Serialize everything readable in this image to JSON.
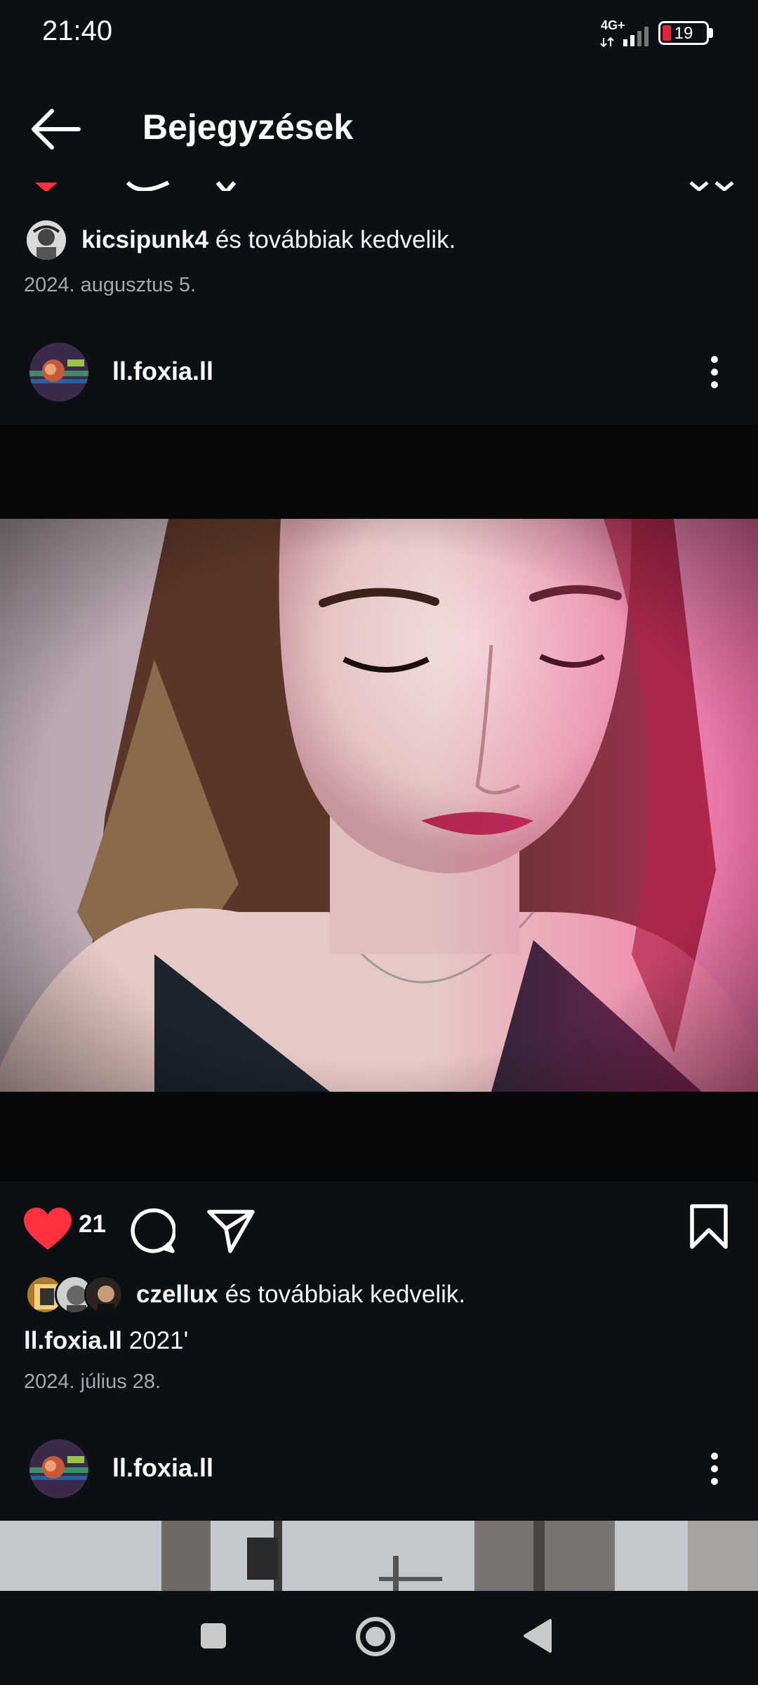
{
  "status_bar": {
    "time": "21:40",
    "network": "4G+",
    "battery": "19"
  },
  "header": {
    "title": "Bejegyzések"
  },
  "previous_post": {
    "liked_by_user": "kicsipunk4",
    "liked_by_suffix": "és továbbiak kedvelik.",
    "date": "2024. augusztus 5."
  },
  "post": {
    "username": "ll.foxia.ll",
    "like_count": "21",
    "liked_by_user": "czellux",
    "liked_by_suffix": "és továbbiak kedvelik.",
    "caption_user": "ll.foxia.ll",
    "caption_text": "2021'",
    "date": "2024. július 28."
  },
  "next_post": {
    "username": "ll.foxia.ll"
  },
  "colors": {
    "background": "#0c1014",
    "like_red": "#ff3040",
    "secondary_text": "#a8a8a8"
  }
}
